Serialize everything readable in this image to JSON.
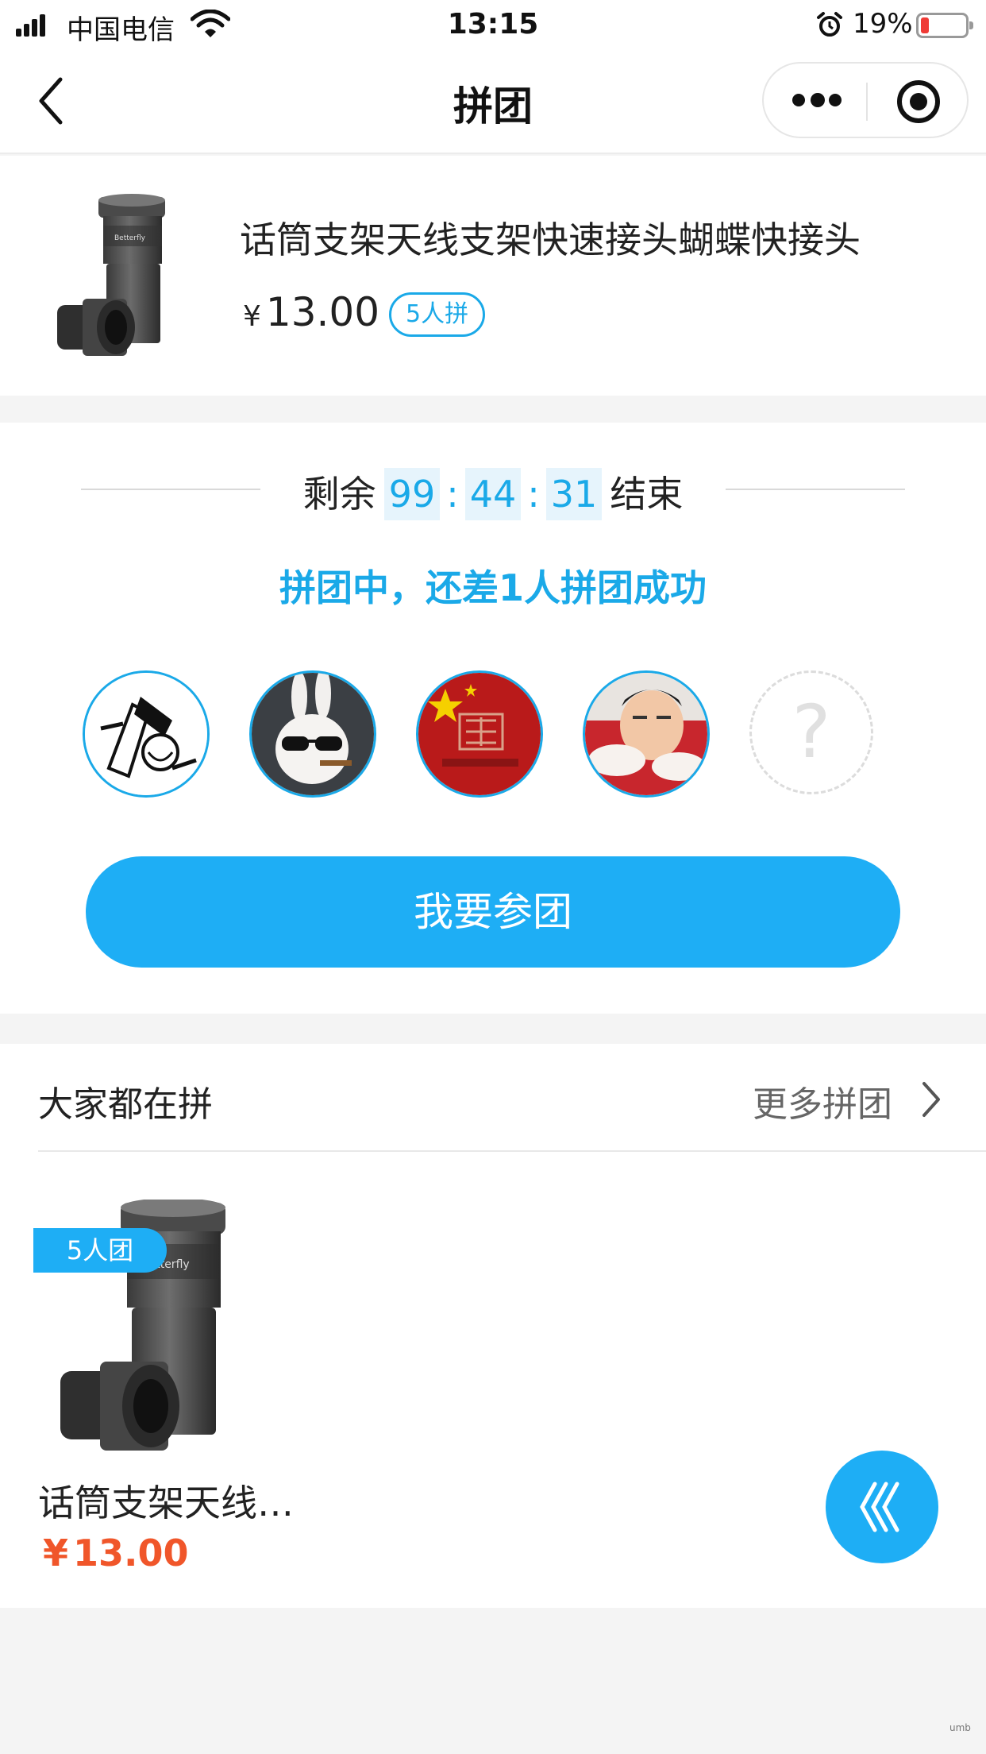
{
  "status_bar": {
    "carrier": "中国电信",
    "time": "13:15",
    "battery_percent": "19%"
  },
  "nav": {
    "title": "拼团"
  },
  "product": {
    "title": "话筒支架天线支架快速接头蝴蝶快接头",
    "currency": "¥",
    "price": "13.00",
    "team_tag": "5人拼"
  },
  "group": {
    "countdown_prefix": "剩余",
    "hours": "99",
    "minutes": "44",
    "seconds": "31",
    "separator": ":",
    "countdown_suffix": "结束",
    "status_text": "拼团中，还差1人拼团成功",
    "avatars": [
      "member-1",
      "member-2",
      "member-3",
      "member-4"
    ],
    "empty_slot": "?",
    "join_button": "我要参团"
  },
  "everyone": {
    "title": "大家都在拼",
    "more": "更多拼团",
    "card": {
      "tag": "5人团",
      "title": "话筒支架天线…",
      "currency": "¥",
      "price": "13.00"
    }
  },
  "watermark": "umb",
  "colors": {
    "accent": "#1eaef5",
    "accent_text": "#1aa9e8",
    "price_red": "#f0562a",
    "battery_low": "#ef3b36"
  },
  "icons": [
    "signal-icon",
    "wifi-icon",
    "alarm-icon",
    "battery-icon",
    "back-icon",
    "more-icon",
    "close-target-icon",
    "chevron-right-icon",
    "back-to-top-icon"
  ]
}
